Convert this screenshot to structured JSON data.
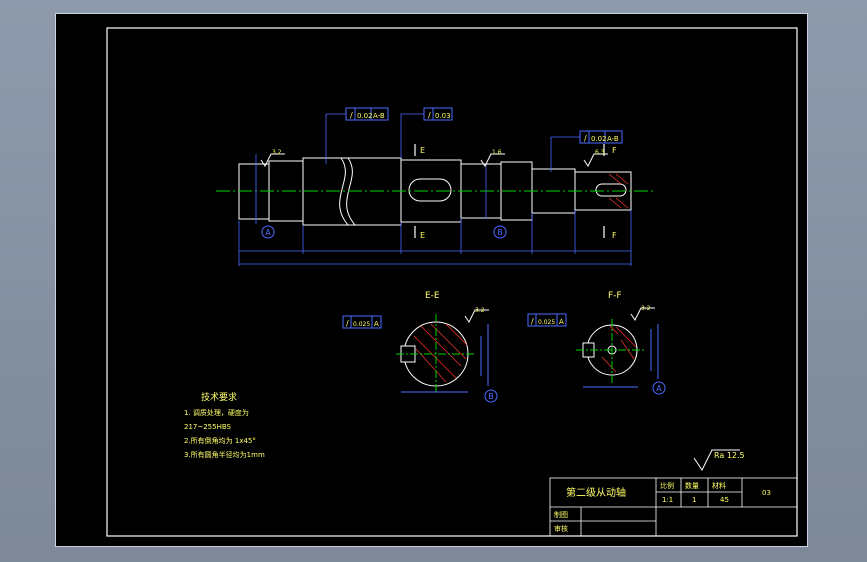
{
  "colors": {
    "background": "#000000",
    "frame": "#ffffff",
    "geometry": "#ffffff",
    "dimensions": "#4b6bff",
    "centerline": "#00d000",
    "hatch": "#ff3333",
    "annotation": "#ffff66",
    "roughness": "#ffffff"
  },
  "tolerances": {
    "left_top": [
      "/",
      "0.02",
      "A-B"
    ],
    "mid_top": [
      "/",
      "0.03"
    ],
    "right_top": [
      "/",
      "0.02",
      "A-B"
    ]
  },
  "section_labels": {
    "e1": "E",
    "e2": "E",
    "f1": "F",
    "f2": "F",
    "title_e": "E-E",
    "title_f": "F-F"
  },
  "datum_labels": {
    "a": "A",
    "b": "B"
  },
  "section_tolerances": {
    "e": [
      "/",
      "0.025",
      "A"
    ],
    "f": [
      "/",
      "0.025",
      "A"
    ]
  },
  "roughness_values": [
    "3.2",
    "1.6",
    "6.3"
  ],
  "tech": {
    "title": "技术要求",
    "lines": [
      "1. 调质处理，硬度为",
      "217~255HBS",
      "2.所有倒角均为 1x45°",
      "3.所有圆角半径均为1mm"
    ]
  },
  "overall_roughness": "Ra 12.5",
  "title_block": {
    "part_name": "第二级从动轴",
    "ratio_label": "比例",
    "qty_label": "数量",
    "material_label": "材料",
    "ratio": "1:1",
    "qty": "1",
    "material": "45",
    "code": "03",
    "drawn_label": "制图",
    "checked_label": "审核"
  }
}
